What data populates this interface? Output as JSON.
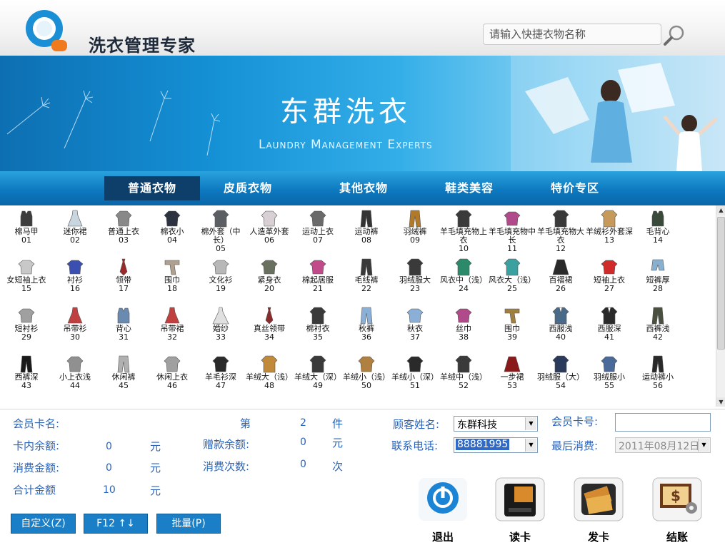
{
  "header": {
    "app_title": "洗衣管理专家",
    "search_placeholder": "请输入快捷衣物名称",
    "logo_icon": "q-logo-icon",
    "search_icon": "magnifier-icon"
  },
  "banner": {
    "title": "东群洗衣",
    "subtitle": "Laundry Management Experts"
  },
  "tabs": [
    {
      "label": "普通衣物",
      "active": true
    },
    {
      "label": "皮质衣物",
      "active": false
    },
    {
      "label": "其他衣物",
      "active": false
    },
    {
      "label": "鞋类美容",
      "active": false
    },
    {
      "label": "特价专区",
      "active": false
    }
  ],
  "garments": [
    {
      "name": "棉马甲",
      "code": "01",
      "icon": "vest-icon",
      "color": "#3c3c3c"
    },
    {
      "name": "迷你裙",
      "code": "02",
      "icon": "dress-icon",
      "color": "#c9d6e0"
    },
    {
      "name": "普通上衣",
      "code": "03",
      "icon": "jacket-icon",
      "color": "#888888"
    },
    {
      "name": "棉衣小",
      "code": "04",
      "icon": "jacket-icon",
      "color": "#2d3240"
    },
    {
      "name": "棉外套（中长）",
      "code": "05",
      "icon": "coat-icon",
      "color": "#5b5e63"
    },
    {
      "name": "人造革外套",
      "code": "06",
      "icon": "jacket-icon",
      "color": "#d8d0d4"
    },
    {
      "name": "运动上衣",
      "code": "07",
      "icon": "jacket-icon",
      "color": "#6a6a6a"
    },
    {
      "name": "运动裤",
      "code": "08",
      "icon": "pants-icon",
      "color": "#333333"
    },
    {
      "name": "羽绒裤",
      "code": "09",
      "icon": "pants-icon",
      "color": "#b07a2a"
    },
    {
      "name": "羊毛填充物上衣",
      "code": "10",
      "icon": "coat-icon",
      "color": "#3a3a3a"
    },
    {
      "name": "羊毛填充物中长",
      "code": "11",
      "icon": "shirt-icon",
      "color": "#b04a8a"
    },
    {
      "name": "羊毛填充物大衣",
      "code": "12",
      "icon": "coat-icon",
      "color": "#3a3a3a"
    },
    {
      "name": "羊绒衫外套深",
      "code": "13",
      "icon": "coat-icon",
      "color": "#c59a5a"
    },
    {
      "name": "毛背心",
      "code": "14",
      "icon": "vest-icon",
      "color": "#3a4a3a"
    },
    {
      "name": "女短袖上衣",
      "code": "15",
      "icon": "shirt-icon",
      "color": "#c8c8c8"
    },
    {
      "name": "衬衫",
      "code": "16",
      "icon": "shirt-icon",
      "color": "#3a4fb0"
    },
    {
      "name": "领带",
      "code": "17",
      "icon": "tie-icon",
      "color": "#9a2a2a"
    },
    {
      "name": "围巾",
      "code": "18",
      "icon": "scarf-icon",
      "color": "#b0a090"
    },
    {
      "name": "文化衫",
      "code": "19",
      "icon": "shirt-icon",
      "color": "#b8b8b8"
    },
    {
      "name": "紧身衣",
      "code": "20",
      "icon": "shirt-icon",
      "color": "#6a7060"
    },
    {
      "name": "棉起居服",
      "code": "21",
      "icon": "shirt-icon",
      "color": "#c04a8a"
    },
    {
      "name": "毛线裤",
      "code": "22",
      "icon": "pants-icon",
      "color": "#3a3a3a"
    },
    {
      "name": "羽绒服大",
      "code": "23",
      "icon": "coat-icon",
      "color": "#3a3a3a"
    },
    {
      "name": "风衣中（浅）",
      "code": "24",
      "icon": "coat-icon",
      "color": "#2a8a6a"
    },
    {
      "name": "风衣大（浅）",
      "code": "25",
      "icon": "coat-icon",
      "color": "#3aa0a0"
    },
    {
      "name": "百褶裙",
      "code": "26",
      "icon": "skirt-icon",
      "color": "#2a2a2a"
    },
    {
      "name": "短袖上衣",
      "code": "27",
      "icon": "shirt-icon",
      "color": "#d02a2a"
    },
    {
      "name": "短裤厚",
      "code": "28",
      "icon": "shorts-icon",
      "color": "#8ab0d0"
    },
    {
      "name": "短衬衫",
      "code": "29",
      "icon": "shirt-icon",
      "color": "#a0a0a0"
    },
    {
      "name": "吊带衫",
      "code": "30",
      "icon": "dress-icon",
      "color": "#c04040"
    },
    {
      "name": "背心",
      "code": "31",
      "icon": "vest-icon",
      "color": "#6a8ab0"
    },
    {
      "name": "吊带裙",
      "code": "32",
      "icon": "dress-icon",
      "color": "#c04040"
    },
    {
      "name": "婚纱",
      "code": "33",
      "icon": "gown-icon",
      "color": "#e0e0e0"
    },
    {
      "name": "真丝领带",
      "code": "34",
      "icon": "tie-icon",
      "color": "#8a2a2a"
    },
    {
      "name": "棉衬衣",
      "code": "35",
      "icon": "coat-icon",
      "color": "#3a3a3a"
    },
    {
      "name": "秋裤",
      "code": "36",
      "icon": "pants-icon",
      "color": "#8ab0d8"
    },
    {
      "name": "秋衣",
      "code": "37",
      "icon": "shirt-icon",
      "color": "#8ab0d8"
    },
    {
      "name": "丝巾",
      "code": "38",
      "icon": "shirt-icon",
      "color": "#b04a8a"
    },
    {
      "name": "围巾",
      "code": "39",
      "icon": "scarf-icon",
      "color": "#a08040"
    },
    {
      "name": "西服浅",
      "code": "40",
      "icon": "suit-icon",
      "color": "#4a6a8a"
    },
    {
      "name": "西服深",
      "code": "41",
      "icon": "suit-icon",
      "color": "#2a2a2a"
    },
    {
      "name": "西裤浅",
      "code": "42",
      "icon": "pants-icon",
      "color": "#4a5040"
    },
    {
      "name": "西裤深",
      "code": "43",
      "icon": "pants-icon",
      "color": "#1a1a1a"
    },
    {
      "name": "小上衣浅",
      "code": "44",
      "icon": "jacket-icon",
      "color": "#909090"
    },
    {
      "name": "休闲裤",
      "code": "45",
      "icon": "pants-icon",
      "color": "#b0b0b0"
    },
    {
      "name": "休闲上衣",
      "code": "46",
      "icon": "jacket-icon",
      "color": "#a0a0a0"
    },
    {
      "name": "羊毛衫深",
      "code": "47",
      "icon": "sweater-icon",
      "color": "#2a2a2a"
    },
    {
      "name": "羊绒大（浅）",
      "code": "48",
      "icon": "coat-icon",
      "color": "#c08a3a"
    },
    {
      "name": "羊绒大（深）",
      "code": "49",
      "icon": "coat-icon",
      "color": "#3a3a3a"
    },
    {
      "name": "羊绒小（浅）",
      "code": "50",
      "icon": "jacket-icon",
      "color": "#b08040"
    },
    {
      "name": "羊绒小（深）",
      "code": "51",
      "icon": "jacket-icon",
      "color": "#2a2a2a"
    },
    {
      "name": "羊绒中（浅）",
      "code": "52",
      "icon": "coat-icon",
      "color": "#3a3a3a"
    },
    {
      "name": "一步裙",
      "code": "53",
      "icon": "skirt-icon",
      "color": "#8a1a1a"
    },
    {
      "name": "羽绒服（大）",
      "code": "54",
      "icon": "coat-icon",
      "color": "#2a3a5a"
    },
    {
      "name": "羽绒服小",
      "code": "55",
      "icon": "jacket-icon",
      "color": "#4a6a9a"
    },
    {
      "name": "运动裤小",
      "code": "56",
      "icon": "pants-icon",
      "color": "#2a2a2a"
    }
  ],
  "info": {
    "member_card_label": "会员卡名:",
    "item_prefix": "第",
    "item_count": "2",
    "item_unit": "件",
    "card_balance_label": "卡内余额:",
    "card_balance": "0",
    "gift_balance_label": "赠款余额:",
    "gift_balance": "0",
    "yuan1": "元",
    "yuan2": "元",
    "spend_label": "消费金额:",
    "spend_amount": "0",
    "yuan3": "元",
    "spend_times_label": "消费次数:",
    "spend_times": "0",
    "times_unit": "次",
    "total_label": "合计金额",
    "total_amount": "10",
    "yuan4": "元",
    "customer_name_label": "顾客姓名:",
    "customer_name": "东群科技",
    "phone_label": "联系电话:",
    "phone": "88881995",
    "member_no_label": "会员卡号:",
    "member_no": "",
    "last_spend_label": "最后消费:",
    "last_spend": "2011年08月12日"
  },
  "buttons": {
    "custom": "自定义(Z)",
    "f12": "F12 ↑↓",
    "batch": "批量(P)"
  },
  "actions": [
    {
      "label": "退出",
      "icon": "power-icon"
    },
    {
      "label": "读卡",
      "icon": "card-reader-icon"
    },
    {
      "label": "发卡",
      "icon": "card-issue-icon"
    },
    {
      "label": "结账",
      "icon": "checkout-icon"
    }
  ],
  "colors": {
    "accent": "#1a7fc6",
    "label_blue": "#2a63b8",
    "active_tab": "#0d3f6a"
  }
}
